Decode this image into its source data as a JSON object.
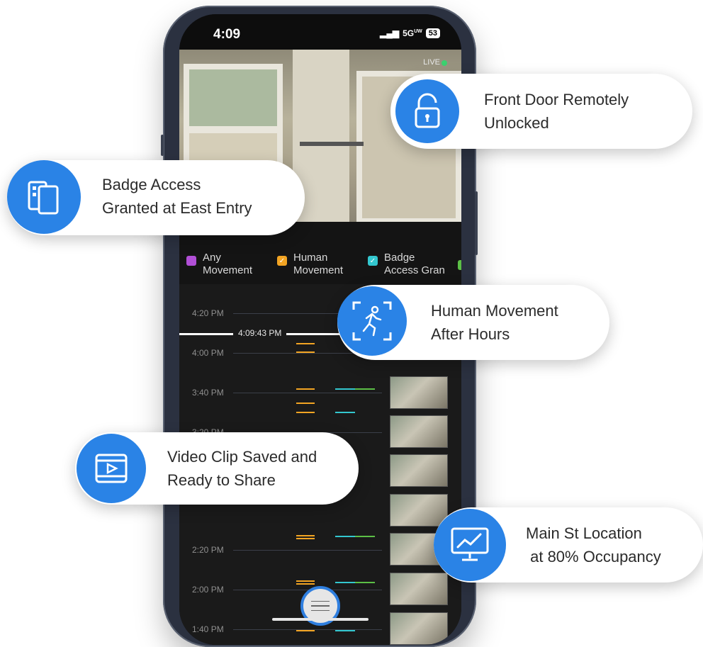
{
  "status_bar": {
    "time": "4:09",
    "network": "5G",
    "network_sup": "UW",
    "battery": "53"
  },
  "camera": {
    "live_label": "LIVE"
  },
  "legend": {
    "items": [
      {
        "label_line1": "Any",
        "label_line2": "Movement",
        "color": "#b14fd6"
      },
      {
        "label_line1": "Human",
        "label_line2": "Movement",
        "color": "#f2a423"
      },
      {
        "label_line1": "Badge",
        "label_line2": "Access Gran",
        "color": "#33c7cf"
      }
    ],
    "partial_item_color": "#5cbf46"
  },
  "timeline": {
    "current_time": "4:09:43 PM",
    "times": [
      "4:20 PM",
      "4:00 PM",
      "3:40 PM",
      "3:20 PM",
      "2:20 PM",
      "2:00 PM",
      "1:40 PM"
    ],
    "colors": {
      "human": "#f2a423",
      "badge": "#33c7cf",
      "green": "#5cbf46"
    }
  },
  "callouts": {
    "front_door": {
      "text": "Front Door Remotely\nUnlocked",
      "icon": "padlock-unlocked-icon"
    },
    "badge_access": {
      "text": "Badge Access\nGranted at East Entry",
      "icon": "badge-cards-icon"
    },
    "human_movement": {
      "text": "Human Movement\nAfter Hours",
      "icon": "running-person-icon"
    },
    "video_clip": {
      "text": "Video Clip Saved and\nReady to Share",
      "icon": "film-play-icon"
    },
    "occupancy": {
      "text": "Main St Location\n at 80% Occupancy",
      "icon": "monitor-chart-icon"
    }
  },
  "accent_color": "#2a83e6"
}
